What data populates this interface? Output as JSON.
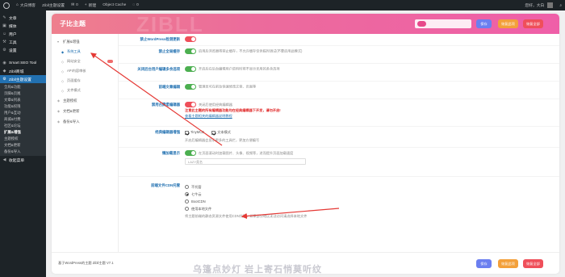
{
  "adminbar": {
    "site_name": "大白博客",
    "theme_settings": "Zibll主题设置",
    "comments_count": "0",
    "new_label": "新建",
    "object_cache": "Object Cache",
    "comments2": "0",
    "greeting": "您好，大白"
  },
  "sidebar": {
    "items": [
      {
        "icon": "pin-icon",
        "label": "文章"
      },
      {
        "icon": "media-icon",
        "label": "媒体"
      },
      {
        "icon": "users-icon",
        "label": "用户"
      },
      {
        "icon": "wrench-icon",
        "label": "工具"
      },
      {
        "icon": "settings-icon",
        "label": "设置"
      },
      {
        "icon": "seo-icon",
        "label": "Smart SEO Tool"
      },
      {
        "icon": "theme-icon",
        "label": "Zibll商城"
      },
      {
        "icon": "gear-icon",
        "label": "Zibll主题设置"
      }
    ],
    "submenu": [
      "全局&功能",
      "页脚&页尾",
      "文章&列表",
      "功能&权限",
      "用户&互动",
      "商城&付费",
      "社区&论坛",
      "扩展&增强",
      "主题授权",
      "文档&更新",
      "备份&导入"
    ],
    "collapse": "收起菜单"
  },
  "panel": {
    "title": "子比主题",
    "watermark": "ZIBLL",
    "buttons": {
      "save": "保存",
      "restore": "恢复此项",
      "reset": "恢复全部"
    },
    "tabs": [
      {
        "label": "扩展&增强",
        "level": 0,
        "selected": false
      },
      {
        "label": "系统工具",
        "level": 1,
        "selected": true
      },
      {
        "label": "网站安全",
        "level": 1,
        "selected": false,
        "hot": true
      },
      {
        "label": "API内容审核",
        "level": 1,
        "selected": false
      },
      {
        "label": "页面缓存",
        "level": 1,
        "selected": false
      },
      {
        "label": "文件模式",
        "level": 1,
        "selected": false
      },
      {
        "label": "主题授权",
        "level": 0,
        "selected": false
      },
      {
        "label": "文档&更新",
        "level": 0,
        "selected": false
      },
      {
        "label": "备份&导入",
        "level": 0,
        "selected": false
      }
    ],
    "rows": {
      "r1": {
        "label": "禁止WordPress检测更新"
      },
      "r2": {
        "label": "禁止全局缓存",
        "desc": "启用后浏览器将禁止缓存，不允许缓存仅供临时调试(不要启用此模式)"
      },
      "r3": {
        "label": "关闭后台用户编辑多余选项",
        "desc": "开启后在后台编辑用户资料时将不显示无用的多余选项"
      },
      "r4": {
        "label": "前端文章编辑",
        "desc": "管理员可在前台快速修改文章、页面等"
      },
      "r5": {
        "label": "禁用古腾堡编辑器",
        "desc": "关闭后使用经典编辑器",
        "warn": "注意此主题的所有编辑器功能均在经典编辑器下开发，请勿开启!",
        "link": "查看主题相关的编辑器说明教程"
      },
      "r6": {
        "label": "经典编辑器增强",
        "opt1": "TinyMCE",
        "opt2": "文本模式",
        "desc": "开启后编辑器会显示更多的工具栏，更加方便编写"
      },
      "r7": {
        "label": "懒加载显示",
        "desc": "在页面滚动时加载图片、头像、视频等，进而提升页面加载速度",
        "input_placeholder": "LAZY类名"
      },
      "r8": {
        "label": "前端文件CDN托管",
        "options": [
          "不托管",
          "七牛云",
          "BootCDN",
          "使用本地文件"
        ],
        "selected": 1,
        "desc": "将主题前端的静态资源文件使用CDN托管，如果部分地区无法访问请选择本地文件"
      }
    },
    "footer_text": "基于WordPress的主题 Zibll主题 V7.1"
  },
  "overlay_text": "乌篷点妙灯 岩上寄石悄莫听纹"
}
